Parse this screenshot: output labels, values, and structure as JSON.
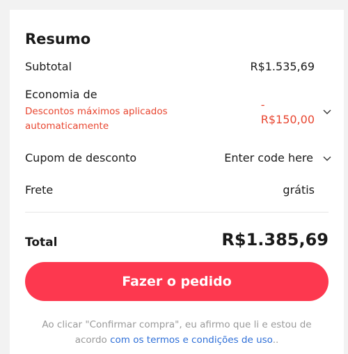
{
  "summary": {
    "title": "Resumo",
    "subtotal_label": "Subtotal",
    "subtotal_value": "R$1.535,69",
    "economy_label": "Economia de",
    "economy_note": "Descontos máximos aplicados automaticamente",
    "economy_dash": "-",
    "economy_value": "R$150,00",
    "coupon_label": "Cupom de desconto",
    "coupon_placeholder": "Enter code here",
    "shipping_label": "Frete",
    "shipping_value": "grátis",
    "total_label": "Total",
    "total_value": "R$1.385,69"
  },
  "actions": {
    "order_button": "Fazer o pedido"
  },
  "terms": {
    "prefix": "Ao clicar \"Confirmar compra\", eu afirmo que li e estou de acordo ",
    "link": "com os termos e condições de uso",
    "suffix": ".."
  },
  "icons": {
    "economy_toggle": "chevron-down-icon",
    "coupon_toggle": "chevron-down-icon"
  },
  "colors": {
    "accent": "#fd384f",
    "discount": "#e8452f",
    "link": "#2e6fd8",
    "muted": "#999999"
  }
}
